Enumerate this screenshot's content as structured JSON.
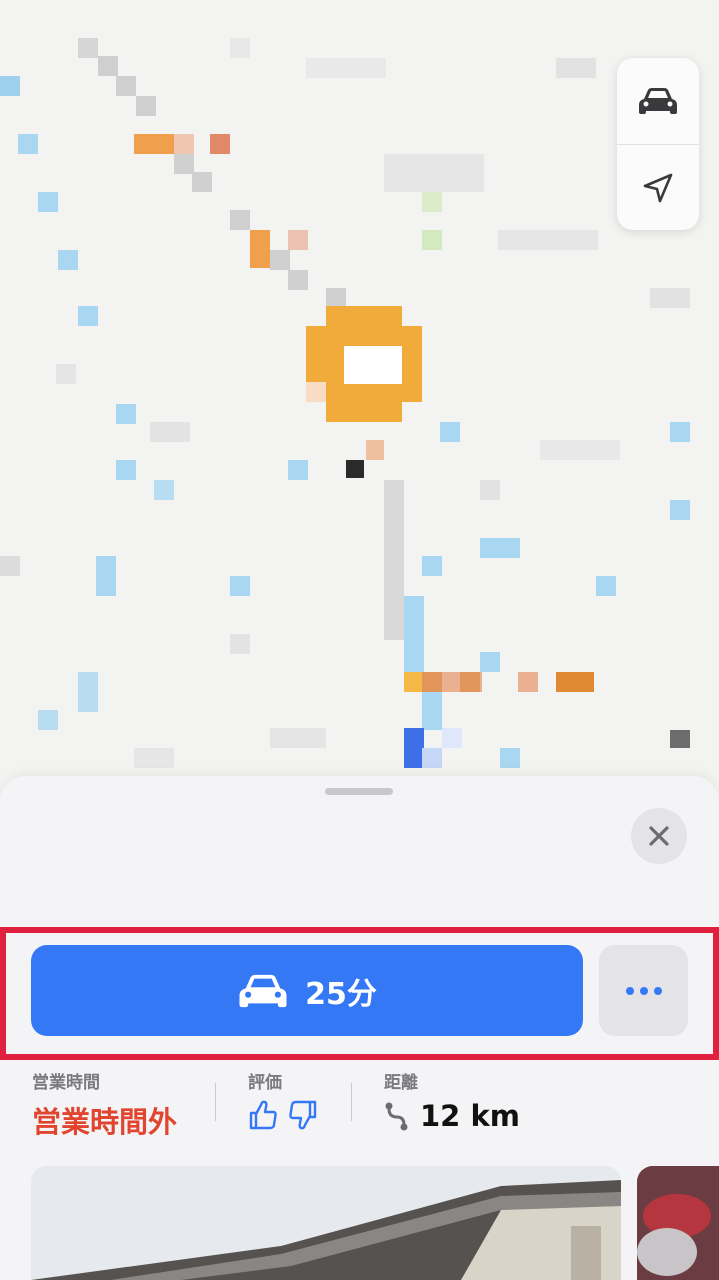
{
  "map": {
    "controls": [
      {
        "icon": "car-icon"
      },
      {
        "icon": "location-arrow-icon"
      }
    ],
    "pin_icon": "place-pin-icon"
  },
  "sheet": {
    "close_icon": "close-icon"
  },
  "actions": {
    "route": {
      "icon": "car-icon",
      "label": "25分",
      "color": "#3478f6"
    },
    "more": {
      "icon": "ellipsis-icon"
    }
  },
  "info": {
    "hours": {
      "label": "営業時間",
      "value": "営業時間外",
      "color": "#e2452f"
    },
    "rating": {
      "label": "評価",
      "icons": [
        "thumbs-up-icon",
        "thumbs-down-icon"
      ]
    },
    "distance": {
      "label": "距離",
      "icon": "route-icon",
      "value": "12 km"
    }
  },
  "colors": {
    "accent": "#3478f6",
    "highlight": "#e0203f",
    "pin": "#f0ab3a"
  }
}
